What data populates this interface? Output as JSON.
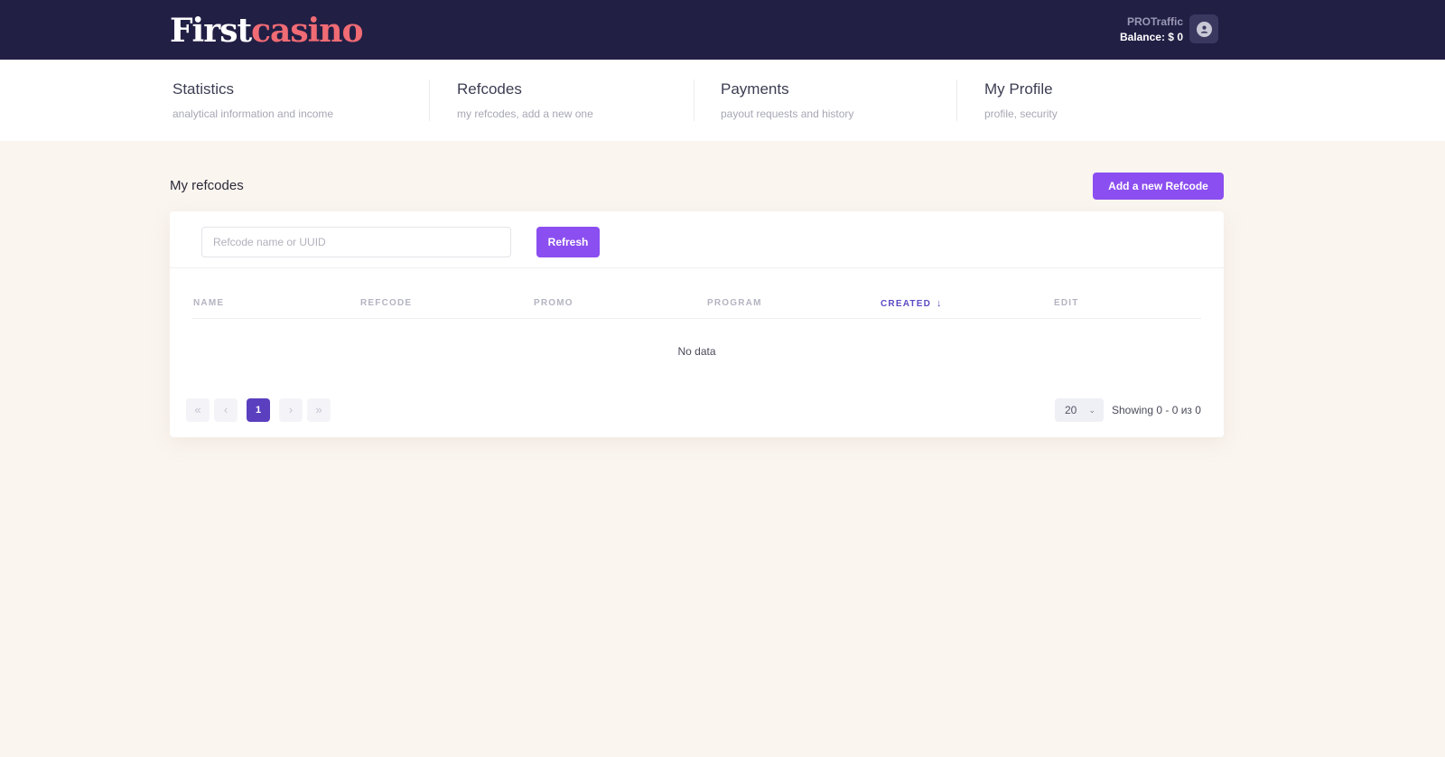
{
  "header": {
    "logo_first": "First",
    "logo_casino": "casino",
    "user_name": "PROTraffic",
    "balance": "Balance: $ 0"
  },
  "nav": {
    "items": [
      {
        "title": "Statistics",
        "subtitle": "analytical information and income"
      },
      {
        "title": "Refcodes",
        "subtitle": "my refcodes, add a new one"
      },
      {
        "title": "Payments",
        "subtitle": "payout requests and history"
      },
      {
        "title": "My Profile",
        "subtitle": "profile, security"
      }
    ]
  },
  "main": {
    "title": "My refcodes",
    "add_button": "Add a new Refcode",
    "search_placeholder": "Refcode name or UUID",
    "refresh_button": "Refresh",
    "columns": [
      "NAME",
      "REFCODE",
      "PROMO",
      "PROGRAM",
      "CREATED",
      "EDIT"
    ],
    "sorted_column": "CREATED",
    "sort_direction": "descending",
    "empty_text": "No data"
  },
  "pagination": {
    "current_page": "1",
    "page_size": "20",
    "showing": "Showing 0 - 0 из 0"
  },
  "colors": {
    "header_bg": "#221f45",
    "accent": "#8b4ef0",
    "active_page": "#5a3fbf",
    "logo_accent": "#f06b74",
    "page_bg": "#faf5ef"
  }
}
